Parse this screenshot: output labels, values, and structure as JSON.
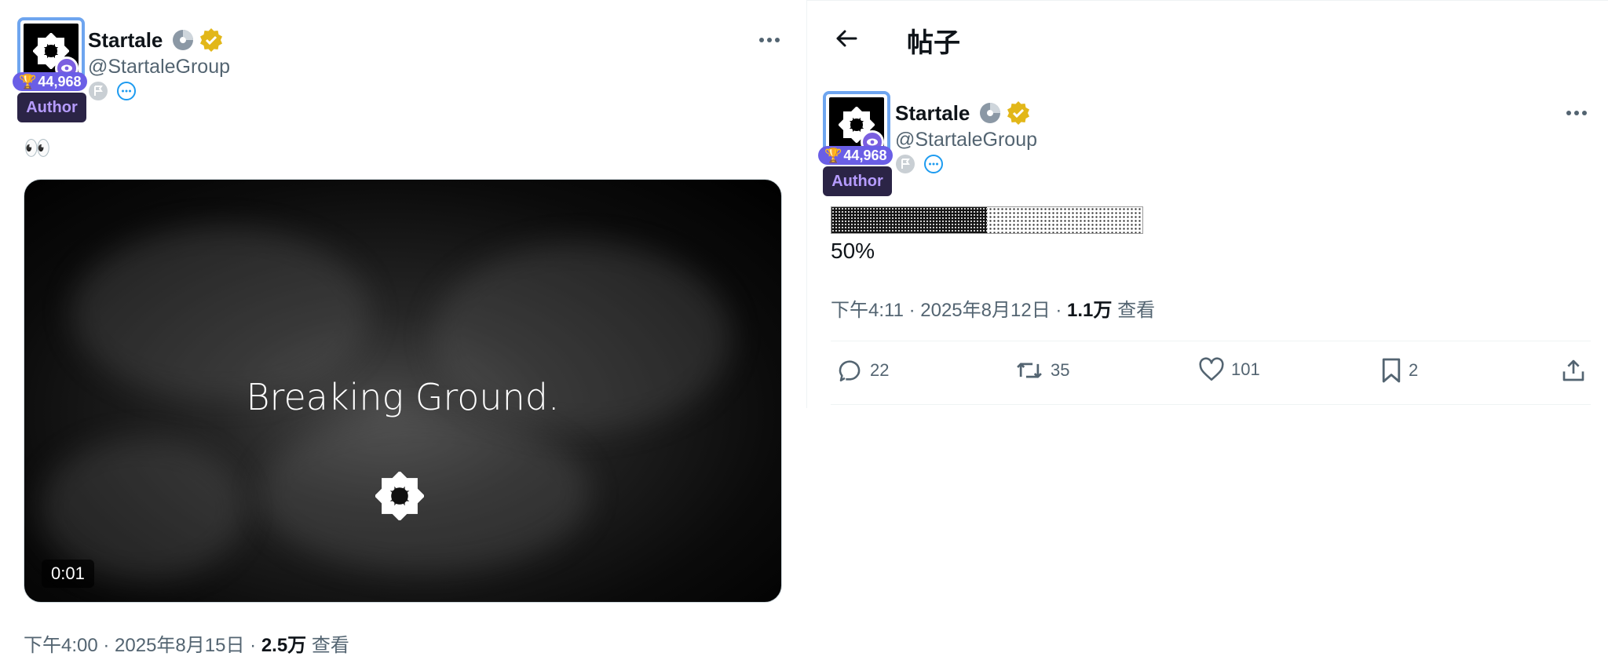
{
  "left_tweet": {
    "author": {
      "display_name": "Startale",
      "handle": "@StartaleGroup",
      "score": "44,968",
      "author_badge": "Author"
    },
    "text": "👀",
    "video": {
      "title": "Breaking Ground.",
      "timestamp": "0:01"
    },
    "meta": {
      "time": "下午4:00 · 2025年8月15日 · ",
      "views": "2.5万",
      "views_label": " 查看"
    }
  },
  "right_panel": {
    "header_title": "帖子",
    "tweet": {
      "author": {
        "display_name": "Startale",
        "handle": "@StartaleGroup",
        "score": "44,968",
        "author_badge": "Author"
      },
      "progress": {
        "value": 0.5,
        "label": "50%"
      },
      "meta": {
        "time": "下午4:11 · 2025年8月12日 · ",
        "views": "1.1万",
        "views_label": " 查看"
      },
      "actions": {
        "replies": "22",
        "reposts": "35",
        "likes": "101",
        "bookmarks": "2"
      }
    }
  },
  "colors": {
    "accent_blue": "#1d9bf0",
    "verified_gold": "#e2b719",
    "score_purple": "#6a5ee6",
    "author_bg": "#2b2446",
    "author_text": "#b69cff",
    "muted_text": "#536471"
  }
}
